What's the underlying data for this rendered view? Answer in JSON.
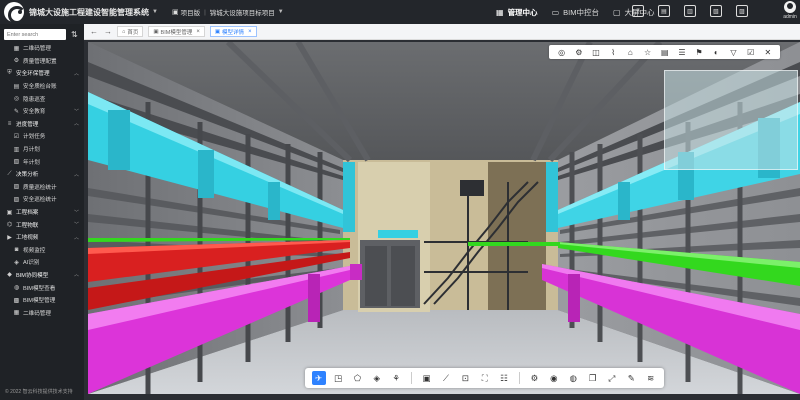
{
  "app": {
    "title": "锦城大设施工程建设智能管理系统",
    "project_type": "项目版",
    "project_name": "锦城大设施项目标项目"
  },
  "top_nav": [
    {
      "label": "管理中心",
      "active": true,
      "icon": "grid-icon"
    },
    {
      "label": "BIM中控台",
      "active": false,
      "icon": "monitor-icon"
    },
    {
      "label": "大屏中心",
      "active": false,
      "icon": "screen-icon"
    }
  ],
  "top_icons": [
    "message-icon",
    "calendar-icon",
    "book-icon",
    "document-icon",
    "bell-icon"
  ],
  "user": {
    "name": "admin"
  },
  "sidebar": {
    "search_placeholder": "Enter search",
    "items": [
      {
        "label": "二维码管理",
        "level": "sub",
        "icon": "qrcode-icon"
      },
      {
        "label": "质量管理配置",
        "level": "sub",
        "icon": "settings-icon"
      },
      {
        "label": "安全环保管理",
        "level": "group",
        "icon": "shield-icon",
        "expanded": true
      },
      {
        "label": "安全质检台账",
        "level": "sub",
        "icon": "ledger-icon"
      },
      {
        "label": "隐患巡查",
        "level": "sub",
        "icon": "inspect-icon"
      },
      {
        "label": "安全教育",
        "level": "sub",
        "icon": "education-icon",
        "expandable": true
      },
      {
        "label": "进度管理",
        "level": "group",
        "icon": "progress-icon",
        "expanded": true
      },
      {
        "label": "计划任务",
        "level": "sub",
        "icon": "task-icon"
      },
      {
        "label": "月计划",
        "level": "sub",
        "icon": "month-icon"
      },
      {
        "label": "年计划",
        "level": "sub",
        "icon": "year-icon"
      },
      {
        "label": "决策分析",
        "level": "group",
        "icon": "analysis-icon",
        "expanded": true
      },
      {
        "label": "质量巡检统计",
        "level": "sub",
        "icon": "stats-icon"
      },
      {
        "label": "安全巡检统计",
        "level": "sub",
        "icon": "stats-icon"
      },
      {
        "label": "工程档案",
        "level": "group",
        "icon": "archive-icon",
        "expandable": true
      },
      {
        "label": "工程物联",
        "level": "group",
        "icon": "iot-icon",
        "expandable": true
      },
      {
        "label": "工地视频",
        "level": "group",
        "icon": "video-icon",
        "expanded": true
      },
      {
        "label": "视频监控",
        "level": "sub",
        "icon": "camera-icon"
      },
      {
        "label": "AI识别",
        "level": "sub",
        "icon": "ai-icon"
      },
      {
        "label": "BIM协同模型",
        "level": "group",
        "icon": "model-icon",
        "expanded": true
      },
      {
        "label": "BIM模型查看",
        "level": "sub",
        "icon": "view-icon"
      },
      {
        "label": "BIM模型管理",
        "level": "sub",
        "icon": "manage-icon"
      },
      {
        "label": "二维码管理",
        "level": "sub",
        "icon": "qrcode-icon"
      }
    ],
    "copyright": "© 2022 智云科技提供技术支持"
  },
  "tabs": [
    {
      "label": "首页",
      "active": false,
      "icon": "home-icon",
      "closable": false
    },
    {
      "label": "BIM模型管理",
      "active": false,
      "icon": "model-icon",
      "closable": true
    },
    {
      "label": "模型详情",
      "active": true,
      "icon": "model-icon",
      "closable": true
    }
  ],
  "viewer_toolbar": [
    "layers-icon",
    "settings-icon",
    "split-icon",
    "attach-icon",
    "home-view-icon",
    "star-icon",
    "table-icon",
    "list-icon",
    "flag-icon",
    "contrast-icon",
    "filter-icon",
    "check-icon",
    "close-icon"
  ],
  "bottom_toolbar": {
    "group1": [
      "walk-icon",
      "camera-icon",
      "pentagon-icon",
      "cube-icon",
      "tree-icon"
    ],
    "group2": [
      "box-icon",
      "measure-icon",
      "section-icon",
      "fit-icon",
      "properties-icon"
    ],
    "group3": [
      "settings-icon",
      "eye-icon",
      "view-icon",
      "copy-icon",
      "fullscreen-icon",
      "edit-icon",
      "layers-icon"
    ],
    "active": "walk-icon"
  },
  "colors": {
    "accent": "#2e82ff",
    "topbar_bg": "#23262b",
    "sidebar_bg": "#1f2226",
    "pipe_cyan": "#38d6e6",
    "pipe_red": "#e0221f",
    "pipe_magenta": "#e437e0",
    "pipe_green": "#37e021",
    "beam_gray": "#8a8d92"
  }
}
